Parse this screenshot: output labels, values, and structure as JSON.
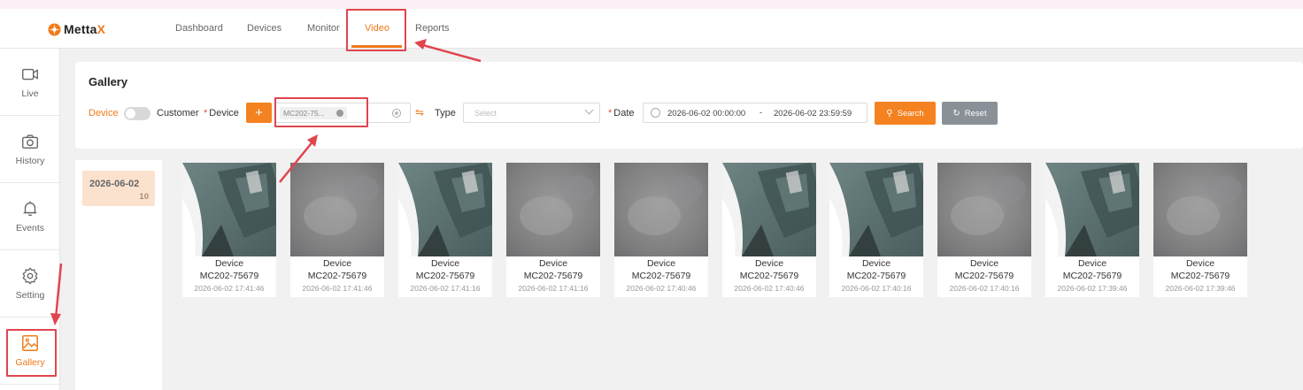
{
  "app": {
    "logo_text": "Metta",
    "logo_accent": "X",
    "accent_color": "#f07a1a"
  },
  "nav": {
    "items": [
      "Dashboard",
      "Devices",
      "Monitor",
      "Video",
      "Reports"
    ],
    "active": "Video"
  },
  "sidebar": {
    "items": [
      {
        "label": "Live",
        "icon": "video-camera-icon"
      },
      {
        "label": "History",
        "icon": "camera-icon"
      },
      {
        "label": "Events",
        "icon": "bell-icon"
      },
      {
        "label": "Setting",
        "icon": "gear-icon"
      },
      {
        "label": "Gallery",
        "icon": "image-icon",
        "active": true
      }
    ]
  },
  "gallery": {
    "title": "Gallery",
    "filters": {
      "toggle_left": "Device",
      "toggle_right": "Customer",
      "device_label": "Device",
      "add_button": "+",
      "device_tag": "MC202-75...",
      "type_label": "Type",
      "type_placeholder": "Select",
      "date_label": "Date",
      "date_start": "2026-06-02 00:00:00",
      "date_sep": "-",
      "date_end": "2026-06-02 23:59:59",
      "search_button": "Search",
      "reset_button": "Reset"
    },
    "dates": [
      {
        "date": "2026-06-02",
        "count": "10"
      }
    ],
    "items": [
      {
        "line1": "Device",
        "line2": "MC202-75679",
        "time": "2026-06-02 17:41:46",
        "variant": "clear"
      },
      {
        "line1": "Device",
        "line2": "MC202-75679",
        "time": "2026-06-02 17:41:46",
        "variant": "foggy"
      },
      {
        "line1": "Device",
        "line2": "MC202-75679",
        "time": "2026-06-02 17:41:16",
        "variant": "clear"
      },
      {
        "line1": "Device",
        "line2": "MC202-75679",
        "time": "2026-06-02 17:41:16",
        "variant": "foggy"
      },
      {
        "line1": "Device",
        "line2": "MC202-75679",
        "time": "2026-06-02 17:40:46",
        "variant": "foggy"
      },
      {
        "line1": "Device",
        "line2": "MC202-75679",
        "time": "2026-06-02 17:40:46",
        "variant": "clear"
      },
      {
        "line1": "Device",
        "line2": "MC202-75679",
        "time": "2026-06-02 17:40:16",
        "variant": "clear"
      },
      {
        "line1": "Device",
        "line2": "MC202-75679",
        "time": "2026-06-02 17:40:16",
        "variant": "foggy"
      },
      {
        "line1": "Device",
        "line2": "MC202-75679",
        "time": "2026-06-02 17:39:46",
        "variant": "clear"
      },
      {
        "line1": "Device",
        "line2": "MC202-75679",
        "time": "2026-06-02 17:39:46",
        "variant": "foggy"
      }
    ]
  }
}
